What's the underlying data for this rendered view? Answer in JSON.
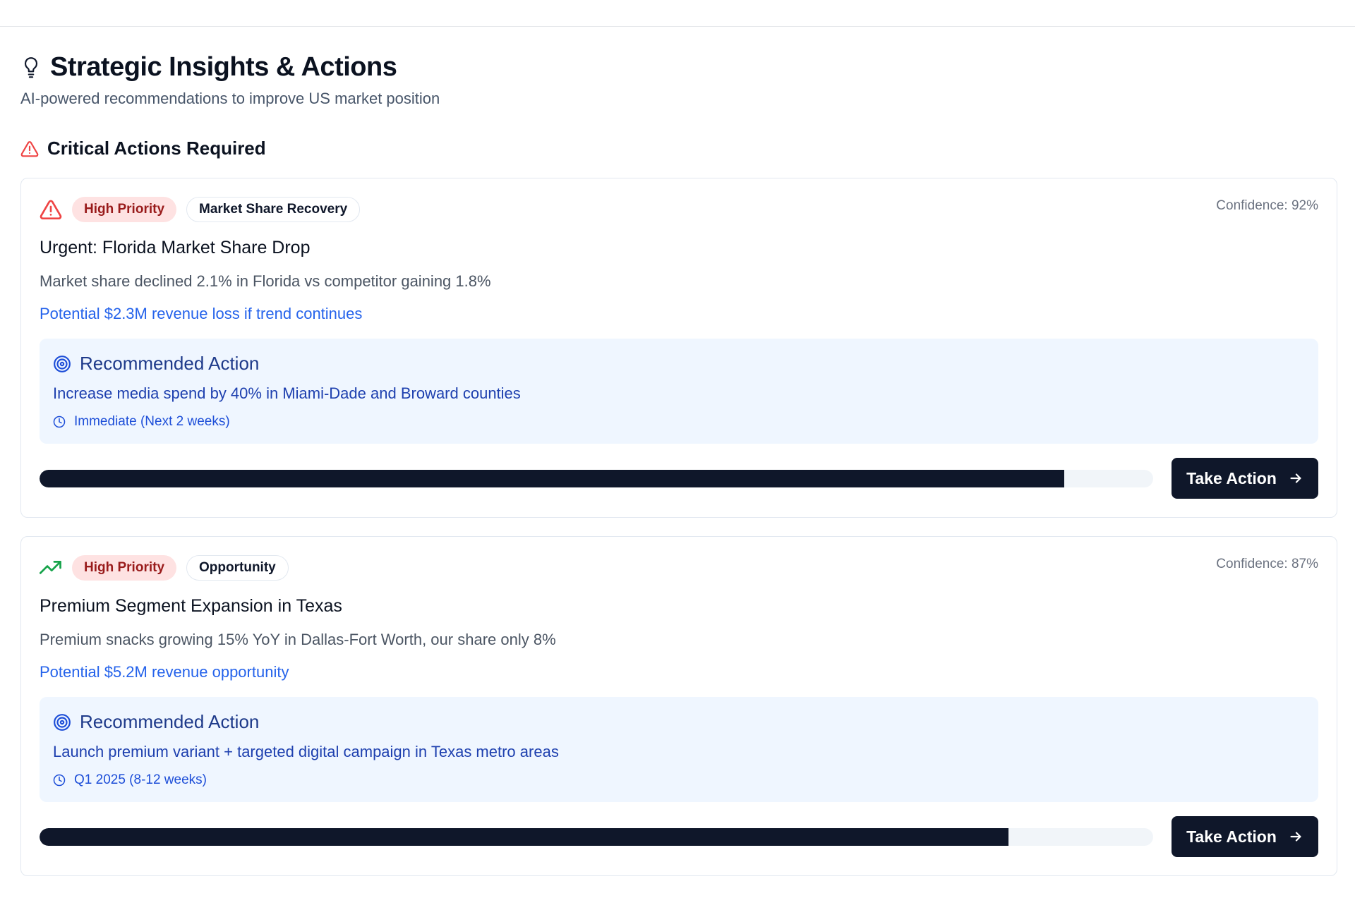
{
  "header": {
    "title": "Strategic Insights & Actions",
    "subtitle": "AI-powered recommendations to improve US market position"
  },
  "section": {
    "title": "Critical Actions Required"
  },
  "cards": [
    {
      "icon": "alert-triangle-icon",
      "priority": "High Priority",
      "category": "Market Share Recovery",
      "confidence": "Confidence: 92%",
      "confidence_value": 0.92,
      "title": "Urgent: Florida Market Share Drop",
      "description": "Market share declined 2.1% in Florida vs competitor gaining 1.8%",
      "impact": "Potential $2.3M revenue loss if trend continues",
      "recommendation": {
        "title": "Recommended Action",
        "text": "Increase media spend by 40% in Miami-Dade and Broward counties",
        "timeline": "Immediate (Next 2 weeks)"
      },
      "button": "Take Action"
    },
    {
      "icon": "trending-up-icon",
      "priority": "High Priority",
      "category": "Opportunity",
      "confidence": "Confidence: 87%",
      "confidence_value": 0.87,
      "title": "Premium Segment Expansion in Texas",
      "description": "Premium snacks growing 15% YoY in Dallas-Fort Worth, our share only 8%",
      "impact": "Potential $5.2M revenue opportunity",
      "recommendation": {
        "title": "Recommended Action",
        "text": "Launch premium variant + targeted digital campaign in Texas metro areas",
        "timeline": "Q1 2025 (8-12 weeks)"
      },
      "button": "Take Action"
    }
  ],
  "colors": {
    "alert_red": "#ef4444",
    "trend_green": "#16a34a",
    "accent_blue": "#2563eb",
    "primary_dark": "#0f172a"
  }
}
